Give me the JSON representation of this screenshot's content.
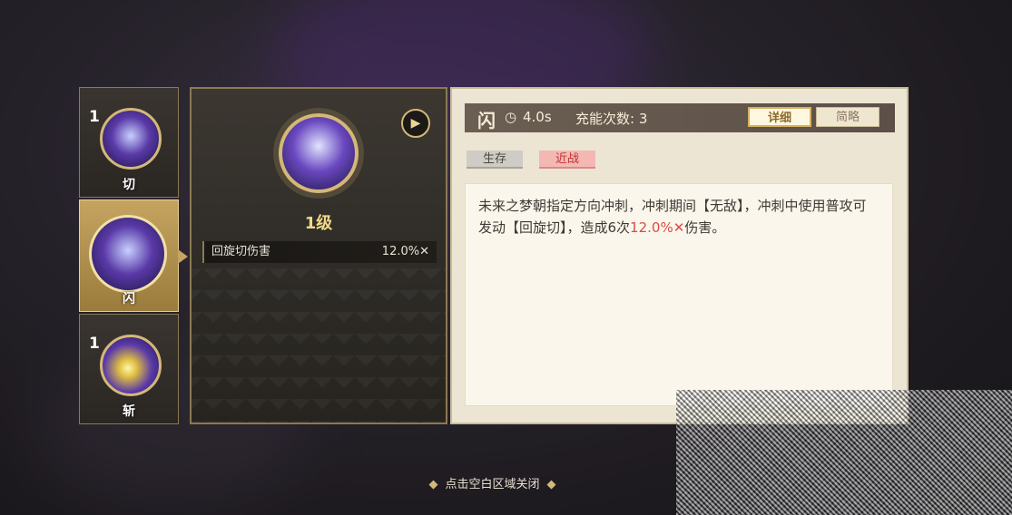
{
  "skills": [
    {
      "level": "1",
      "name": "切",
      "icon": "slash-skill-icon"
    },
    {
      "level": "",
      "name": "闪",
      "icon": "character-portrait-icon"
    },
    {
      "level": "1",
      "name": "斩",
      "icon": "burst-skill-icon"
    }
  ],
  "detail": {
    "level_label": "1级",
    "damage_label": "回旋切伤害",
    "damage_value": "12.0%✕"
  },
  "header": {
    "name": "闪",
    "clock_icon": "◷",
    "cooldown": "4.0s",
    "charges": "充能次数: 3",
    "tab_detail": "详细",
    "tab_brief": "简略"
  },
  "tags": {
    "survive": "生存",
    "melee": "近战"
  },
  "description": {
    "part1": "未来之梦朝指定方向冲刺，冲刺期间【无敌】，冲刺中使用普攻可发动【回旋切】，造成6次",
    "highlight": "12.0%✕",
    "part2": "伤害。"
  },
  "footer": {
    "diamond_left": "◆",
    "hint": "点击空白区域关闭",
    "diamond_right": "◆"
  },
  "colors": {
    "accent_gold": "#d4b878",
    "melee_red": "#e04a44"
  }
}
